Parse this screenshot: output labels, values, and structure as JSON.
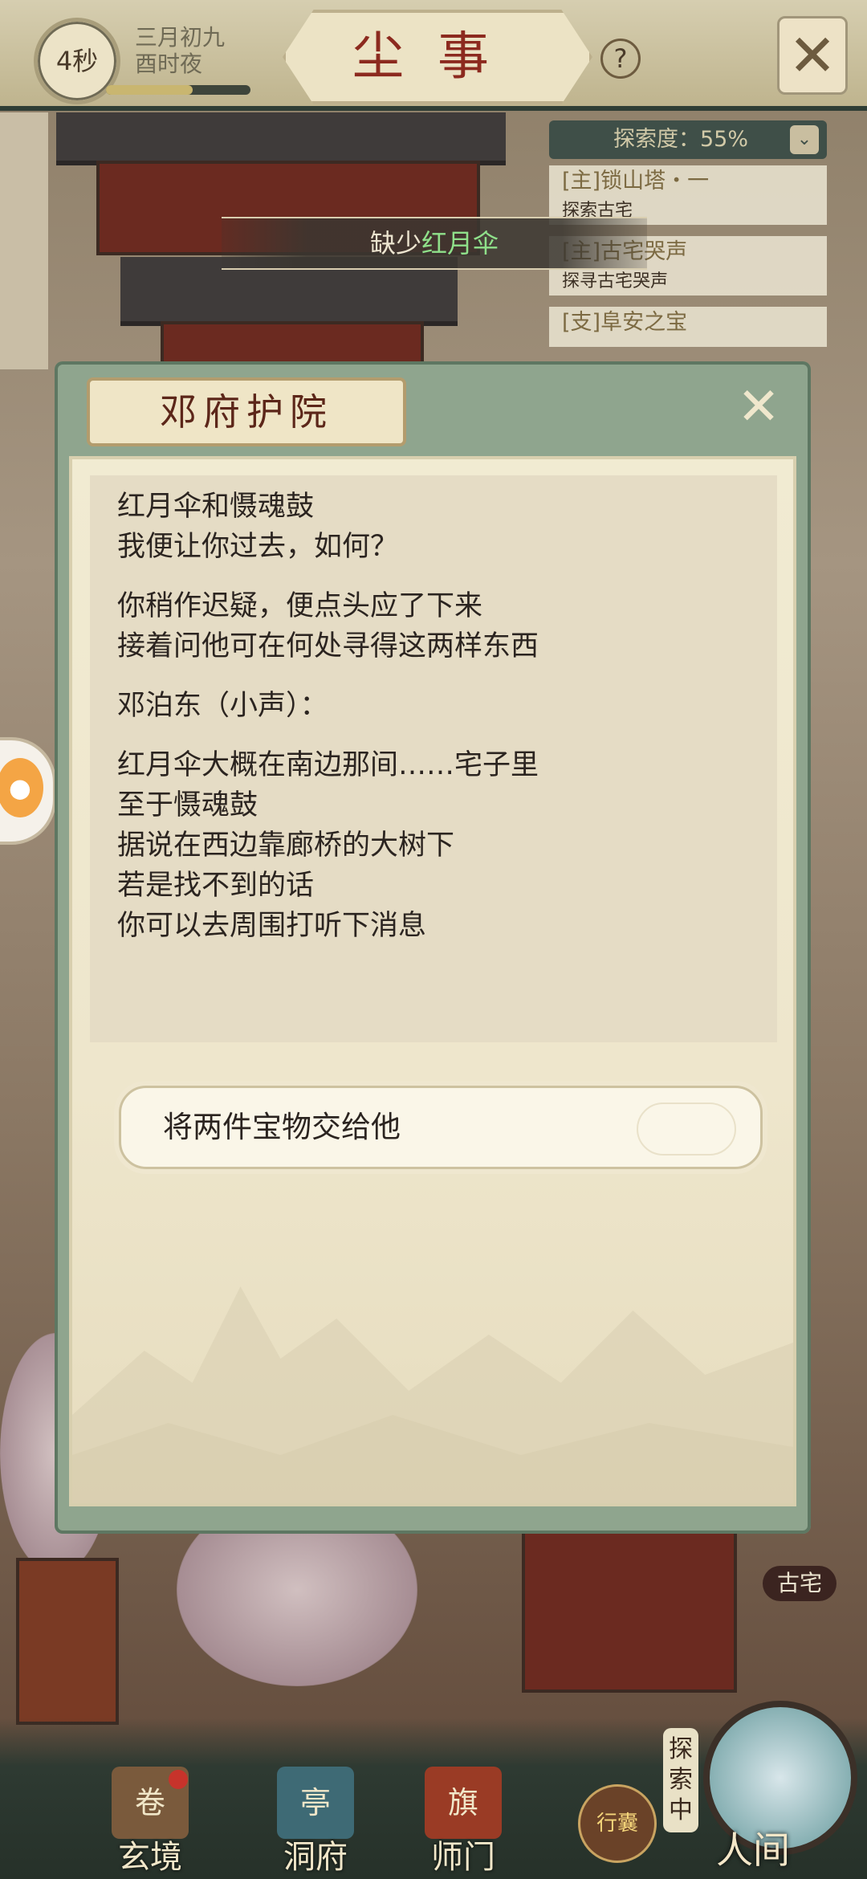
{
  "top": {
    "timer": "4秒",
    "date_line1": "三月初九",
    "date_line2": "酉时夜",
    "title": "尘事",
    "help": "?",
    "close": "✕"
  },
  "quest": {
    "explore": "探索度：55%",
    "items": [
      {
        "title": "[主]锁山塔・一",
        "sub": "探索古宅"
      },
      {
        "title": "[主]古宅哭声",
        "sub": "探寻古宅哭声"
      },
      {
        "title": "[支]阜安之宝",
        "sub": ""
      }
    ]
  },
  "banner": {
    "prefix": "缺少",
    "item": "红月伞"
  },
  "dialog": {
    "title": "邓府护院",
    "close": "✕",
    "lines": [
      "红月伞和慑魂鼓",
      "我便让你过去，如何？",
      "",
      "你稍作迟疑，便点头应了下来",
      "接着问他可在何处寻得这两样东西",
      "",
      "邓泊东（小声）：",
      "",
      "红月伞大概在南边那间……宅子里",
      "至于慑魂鼓",
      "据说在西边靠廊桥的大树下",
      "若是找不到的话",
      "你可以去周围打听下消息"
    ],
    "choice": "将两件宝物交给他"
  },
  "location_tag": "古宅",
  "nav": {
    "items": [
      {
        "label": "玄境",
        "icon": "scroll-icon"
      },
      {
        "label": "洞府",
        "icon": "pavilion-icon"
      },
      {
        "label": "师门",
        "icon": "banner-icon"
      }
    ],
    "bag_label": "行囊",
    "explore_tag": "探索中",
    "world_label": "人间"
  },
  "colors": {
    "accent_green": "#8fe08a",
    "title_red": "#8c2a1f",
    "panel_green": "#8fa58e"
  }
}
